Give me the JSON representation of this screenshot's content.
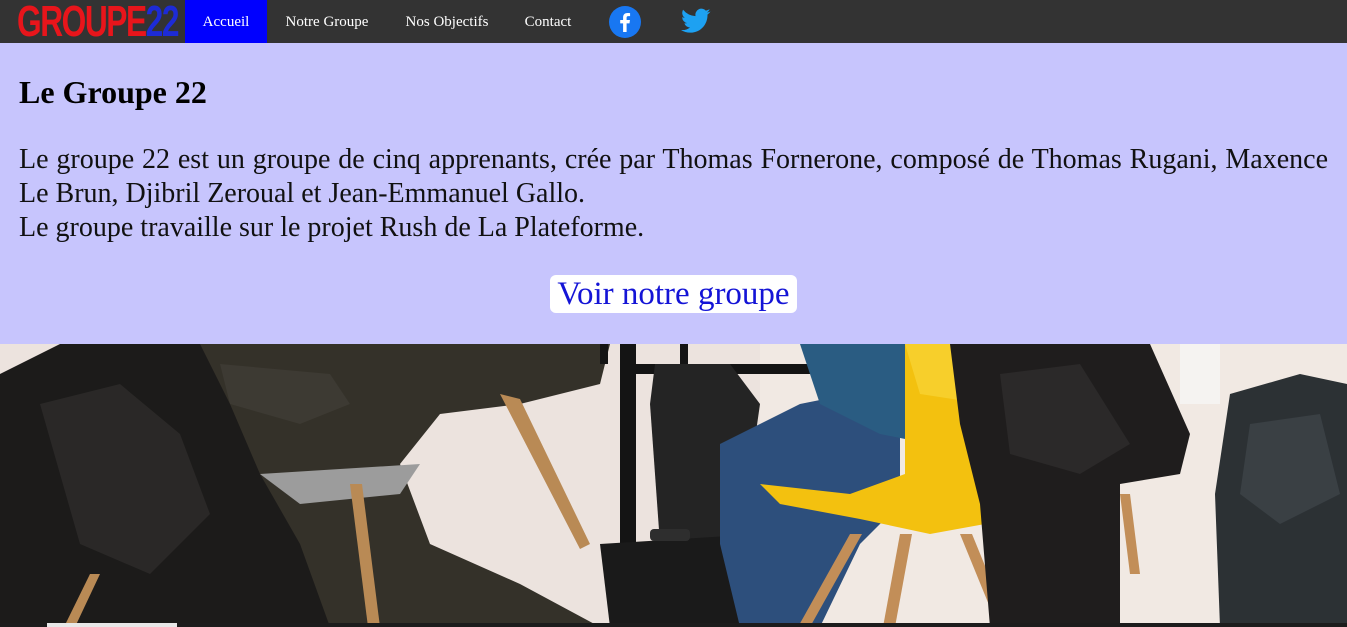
{
  "brand": {
    "part1": "GROUPE",
    "part2": "22"
  },
  "nav": {
    "items": [
      {
        "label": "Accueil",
        "active": true
      },
      {
        "label": "Notre Groupe",
        "active": false
      },
      {
        "label": "Nos Objectifs",
        "active": false
      },
      {
        "label": "Contact",
        "active": false
      }
    ],
    "social": [
      "facebook-icon",
      "twitter-icon"
    ]
  },
  "main": {
    "title": "Le Groupe 22",
    "paragraph_line1": "Le groupe 22 est un groupe de cinq apprenants, crée par Thomas Fornerone, composé de Thomas Rugani, Maxence Le Brun, Djibril Zeroual et Jean-Emmanuel Gallo.",
    "paragraph_line2": "Le groupe travaille sur le projet Rush de La Plateforme.",
    "cta_label": "Voir notre groupe"
  },
  "colors": {
    "navbar": "#333333",
    "active_nav": "#0000ff",
    "background": "#c7c5fd",
    "logo_red": "#e8151b",
    "logo_blue": "#1d2bd6",
    "cta_text": "#1414d6"
  }
}
